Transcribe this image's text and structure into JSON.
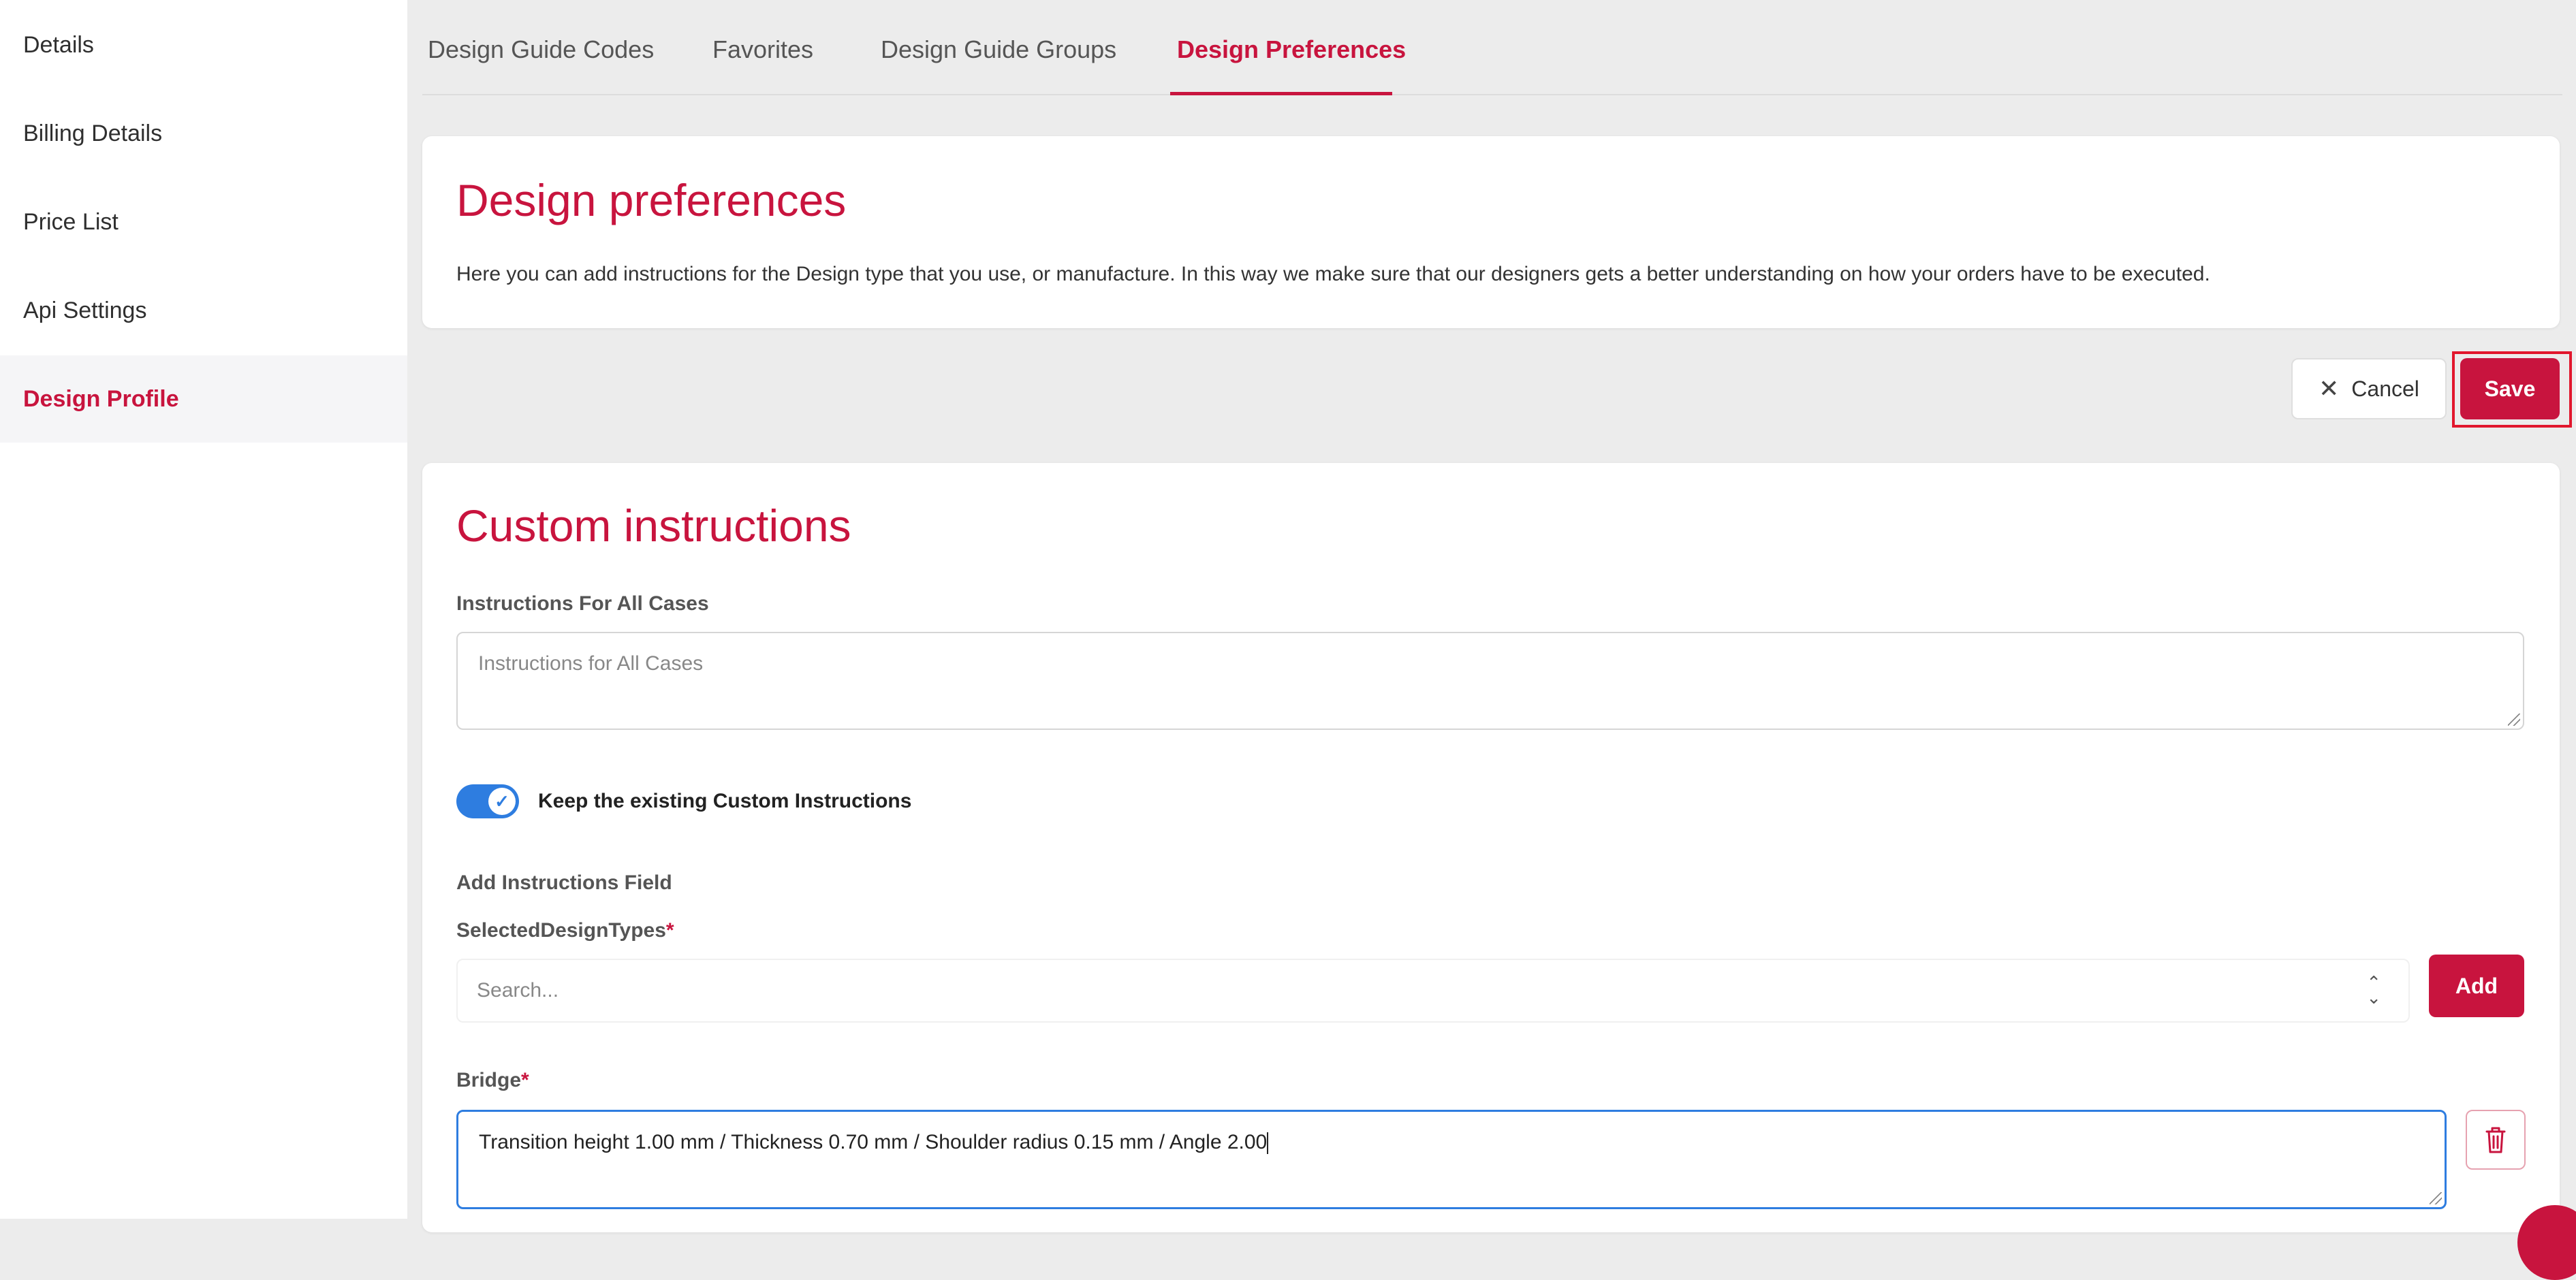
{
  "sidebar": {
    "items": [
      {
        "label": "Details",
        "active": false
      },
      {
        "label": "Billing Details",
        "active": false
      },
      {
        "label": "Price List",
        "active": false
      },
      {
        "label": "Api Settings",
        "active": false
      },
      {
        "label": "Design Profile",
        "active": true
      }
    ]
  },
  "tabs": {
    "items": [
      {
        "label": "Design Guide Codes"
      },
      {
        "label": "Favorites"
      },
      {
        "label": "Design Guide Groups"
      },
      {
        "label": "Design Preferences"
      }
    ],
    "active_index": 3
  },
  "preferences": {
    "title": "Design preferences",
    "description": "Here you can add instructions for the Design type that you use, or manufacture. In this way we make sure that our designers gets a better understanding on how your orders have to be executed."
  },
  "actions": {
    "cancel_label": "Cancel",
    "save_label": "Save"
  },
  "custom": {
    "title": "Custom instructions",
    "all_cases_label": "Instructions For All Cases",
    "all_cases_placeholder": "Instructions for All Cases",
    "all_cases_value": "",
    "keep_existing": {
      "label": "Keep the existing Custom Instructions",
      "checked": true
    },
    "add_field_label": "Add Instructions Field",
    "design_types_label": "SelectedDesignTypes",
    "required_mark": "*",
    "search_placeholder": "Search...",
    "add_label": "Add",
    "bridge": {
      "label": "Bridge",
      "value": "Transition height 1.00 mm / Thickness 0.70 mm / Shoulder radius 0.15 mm / Angle 2.00"
    }
  },
  "colors": {
    "accent": "#c8143e",
    "focus_blue": "#2e7de0",
    "highlight_box": "#e1172d"
  }
}
